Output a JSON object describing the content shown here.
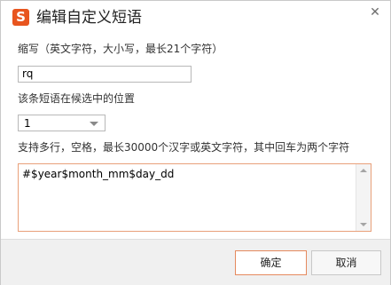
{
  "dialog": {
    "logo_letter": "S",
    "title": "编辑自定义短语",
    "close_glyph": "✕"
  },
  "abbreviation": {
    "label": "缩写（英文字符，大小写，最长21个字符）",
    "value": "rq"
  },
  "position": {
    "label": "该条短语在候选中的位置",
    "selected": "1"
  },
  "phrase": {
    "label": "支持多行，空格，最长30000个汉字或英文字符，其中回车为两个字符",
    "value": "#$year$month_mm$day_dd"
  },
  "buttons": {
    "ok": "确定",
    "cancel": "取消"
  },
  "colors": {
    "brand": "#e8551f",
    "focus_border": "#e9a07a",
    "footer_bg": "#f0f0f0"
  }
}
